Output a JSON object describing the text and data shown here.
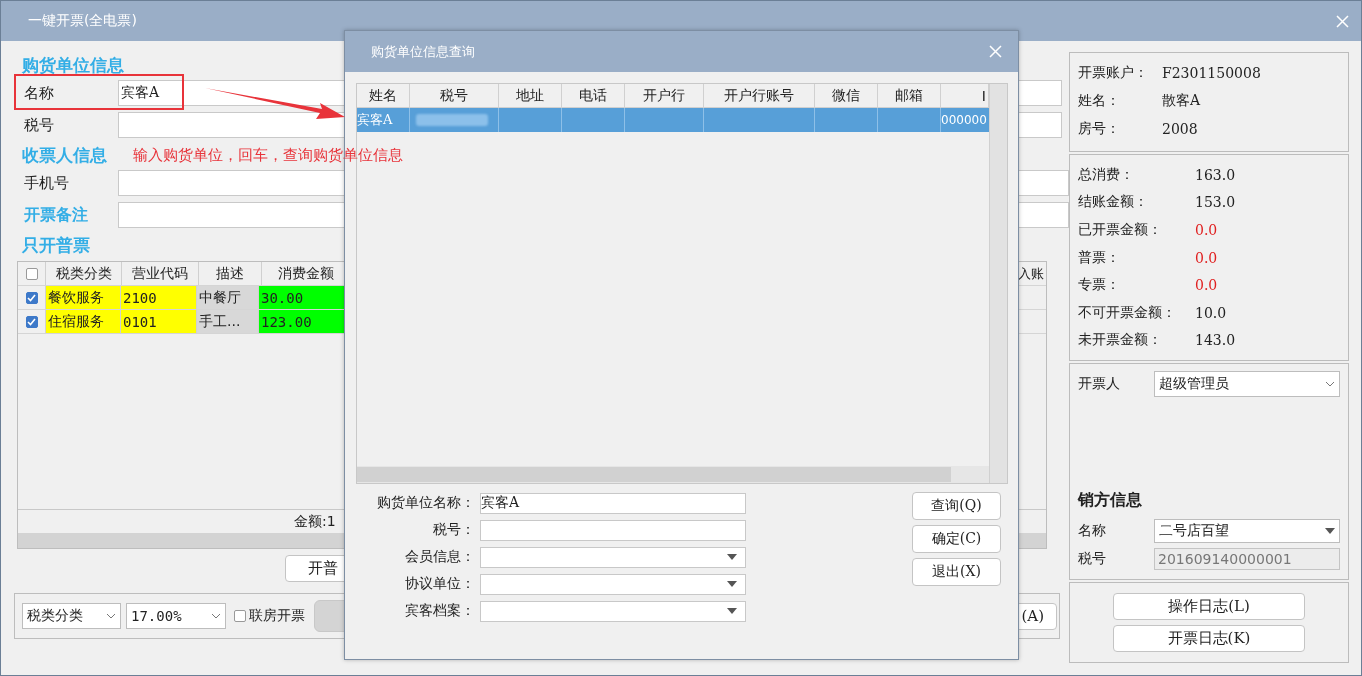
{
  "window": {
    "title": "一键开票(全电票)"
  },
  "buyer": {
    "heading": "购货单位信息",
    "fields": [
      {
        "label": "名称",
        "value": "宾客A",
        "highlighted": true
      },
      {
        "label": "税号"
      }
    ]
  },
  "annotation": {
    "text": "输入购货单位，回车，查询购货单位信息"
  },
  "receiver": {
    "heading": "收票人信息",
    "fields": [
      {
        "label": "手机号",
        "kind": "plain"
      },
      {
        "label": "开票备注",
        "kind": "heading"
      }
    ]
  },
  "items": {
    "heading": "只开普票",
    "all_checked": false,
    "columns": [
      "税类分类",
      "营业代码",
      "描述",
      "消费金额"
    ],
    "column_cut": "入账",
    "rows": [
      {
        "checked": true,
        "category": "餐饮服务",
        "code": "2100",
        "description": "中餐厅",
        "amount": "30.00"
      },
      {
        "checked": true,
        "category": "住宿服务",
        "code": "0101",
        "description": "手工...",
        "amount": "123.00"
      }
    ],
    "footer": "金额:1",
    "button": "开普"
  },
  "bottom": {
    "tax_select": "税类分类",
    "rate_select": "17.00%",
    "checkbox": {
      "label": "联房开票",
      "checked": false
    },
    "greyed_button": {
      "disabled": true
    },
    "button": "(A)"
  },
  "account": [
    {
      "label": "开票账户：",
      "value": "F2301150008"
    },
    {
      "label": "姓名：",
      "value": "散客A"
    },
    {
      "label": "房号：",
      "value": "2008"
    }
  ],
  "totals": [
    {
      "label": "总消费：",
      "value": "163.0",
      "alert": false
    },
    {
      "label": "结账金额：",
      "value": "153.0",
      "alert": false
    },
    {
      "label": "已开票金额：",
      "value": "0.0",
      "alert": true
    },
    {
      "label": "普票：",
      "value": "0.0",
      "alert": true
    },
    {
      "label": "专票：",
      "value": "0.0",
      "alert": true
    },
    {
      "label": "不可开票金额：",
      "value": "10.0",
      "alert": false
    },
    {
      "label": "未开票金额：",
      "value": "143.0",
      "alert": false
    }
  ],
  "issuer": {
    "label": "开票人",
    "value": "超级管理员"
  },
  "seller": {
    "heading": "销方信息",
    "name_label": "名称",
    "name": "二号店百望",
    "tax_label": "税号",
    "tax": {
      "value": "201609140000001",
      "disabled": true
    }
  },
  "log_buttons": [
    "操作日志(L)",
    "开票日志(K)"
  ],
  "dialog": {
    "title": "购货单位信息查询",
    "columns": [
      "姓名",
      "税号",
      "地址",
      "电话",
      "开户行",
      "开户行账号",
      "微信",
      "邮箱",
      "I"
    ],
    "rows": [
      {
        "selected": true,
        "name": "宾客A",
        "column_9": "000000"
      }
    ],
    "fields": [
      {
        "label": "购货单位名称：",
        "kind": "text",
        "value": "宾客A"
      },
      {
        "label": "税号：",
        "kind": "text"
      },
      {
        "label": "会员信息：",
        "kind": "select"
      },
      {
        "label": "协议单位：",
        "kind": "select"
      },
      {
        "label": "宾客档案：",
        "kind": "select"
      }
    ],
    "buttons": [
      "查询(Q)",
      "确定(C)",
      "退出(X)"
    ]
  }
}
